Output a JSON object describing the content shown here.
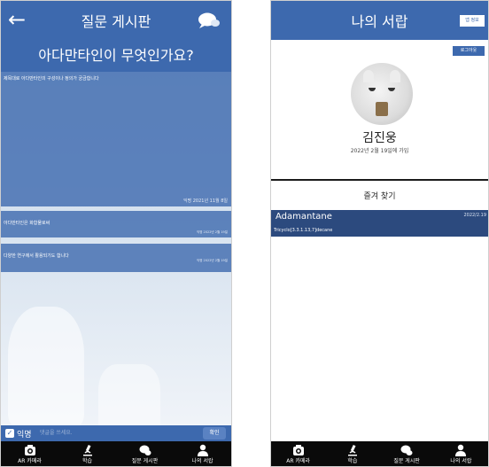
{
  "left": {
    "header": {
      "title": "질문 게시판",
      "back_icon": "←"
    },
    "question_title": "아다만타인이 무엇인가요?",
    "posts": [
      {
        "text": "제목대로 아다만타인의 구성이나 정의가 궁금합니다",
        "date": "익명 2021년 11월 8일"
      },
      {
        "text": "아다만타인은 화합물로써",
        "date": "익명 2022년 2월 19일"
      },
      {
        "text": "다양한 연구에서 활용되기도 합니다",
        "date": "익명 2022년 2월 19일"
      }
    ],
    "comment": {
      "anon_label": "익명",
      "placeholder": "댓글을 쓰세요.",
      "confirm": "확인",
      "check": "✓"
    }
  },
  "right": {
    "header": {
      "title": "나의 서랍"
    },
    "profile_button": "앱 정보",
    "logout_button": "로그아웃",
    "username": "김진웅",
    "joined": "2022년 2월 19일에 가입",
    "favorites_title": "즐겨 찾기",
    "favorite": {
      "name": "Adamantane",
      "formula": "Tricyclo[3.3.1.13,7]decane",
      "date": "2022/2.19"
    }
  },
  "tabs": [
    {
      "label": "AR 카메라",
      "icon": "camera-icon"
    },
    {
      "label": "학습",
      "icon": "microscope-icon"
    },
    {
      "label": "질문 게시판",
      "icon": "chat-icon"
    },
    {
      "label": "나의 서랍",
      "icon": "person-icon"
    }
  ],
  "colors": {
    "primary": "#3d69ae",
    "tabbar": "#0a0a0a",
    "favorite": "#2c4a7e"
  }
}
